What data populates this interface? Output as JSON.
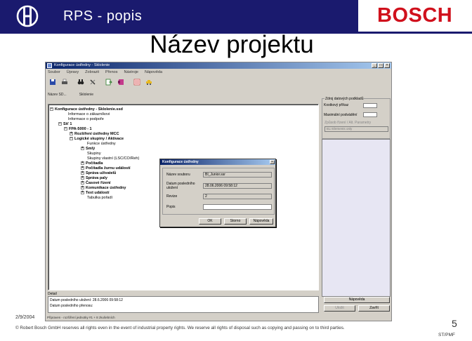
{
  "header": {
    "title": "RPS - popis",
    "brand": "BOSCH"
  },
  "slide": {
    "heading": "Název projektu"
  },
  "app": {
    "window_title": "Konfigurace ústředny - Sklolenie",
    "menu": [
      "Soubor",
      "Úpravy",
      "Zobrazit",
      "Přenos",
      "Nástroje",
      "Nápověda"
    ],
    "toolbar_icons": [
      "save-icon",
      "print-icon",
      "binoculars-icon",
      "tools-icon",
      "export-icon",
      "import-icon",
      "folder-icon",
      "list-icon",
      "car-icon"
    ],
    "toolbar_labels": [
      "Název SD...",
      "Sklolenie"
    ],
    "tree": [
      {
        "label": "Konfigurace ústředny - Sklolenie.ssd",
        "bold": true
      },
      {
        "label": "Informace o zákazníkovi",
        "bold": false
      },
      {
        "label": "Informace o podpoře",
        "bold": false
      },
      {
        "label": "Síť 1",
        "bold": true
      },
      {
        "label": "FPA-5000 - 1",
        "bold": true
      },
      {
        "label": "Rozšíření ústředny MCC",
        "bold": true
      },
      {
        "label": "Logické skupiny / Aktivace",
        "bold": true
      },
      {
        "label": "Funkce ústředny",
        "bold": false
      },
      {
        "label": "Smlý",
        "bold": true
      },
      {
        "label": "Skupiny",
        "bold": false
      },
      {
        "label": "Skupiny vlastní (LSC/CO/Reh)",
        "bold": false
      },
      {
        "label": "Počítadla",
        "bold": true
      },
      {
        "label": "Počítadla žurnu událostí",
        "bold": true
      },
      {
        "label": "Správa uživatelů",
        "bold": true
      },
      {
        "label": "Správa paly",
        "bold": true
      },
      {
        "label": "Časové řízení",
        "bold": true
      },
      {
        "label": "Komunikace ústředny",
        "bold": true
      },
      {
        "label": "Text událostí",
        "bold": true
      },
      {
        "label": "Tabulka pořadí",
        "bold": false
      }
    ],
    "right_panel": {
      "group_title": "Zdroj datových podkladů",
      "label1": "Kostkový příkaz",
      "label2": "Maximální podvádění",
      "select_label": "Způsob řízení / Alt. Parametry",
      "select_value": "ELI Elements only"
    },
    "detail": {
      "label": "Detail",
      "rows": [
        "Datum posledního uložení:  28.6.2006 09:58:12",
        "Datum posledního přenosu:"
      ]
    },
    "buttons": {
      "help": "Nápověda",
      "ok_disabled": "Uložit",
      "close": "Zavřít"
    },
    "statusbar": "Připraven - rozšíření jednotky #1 + 8 zkušebních"
  },
  "dialog": {
    "title": "Konfigurace ústředny",
    "fields": [
      {
        "label": "Název souboru",
        "value": "BI_Junior.ssr",
        "editable": false
      },
      {
        "label": "Datum posledního uložení",
        "value": "28.06.2006 09:58:12",
        "editable": false
      },
      {
        "label": "Revize",
        "value": "2",
        "editable": false
      },
      {
        "label": "Popis",
        "value": "",
        "editable": true
      }
    ],
    "ok": "OK",
    "cancel": "Storno",
    "help": "Nápověda"
  },
  "footer": {
    "date": "2/9/2004",
    "copyright": "© Robert Bosch GmbH reserves all rights even in the event of industrial property rights. We reserve all rights of disposal such as copying and passing on to third parties.",
    "page": "5",
    "dept": "ST/PMF"
  },
  "colors": {
    "header_blue": "#1a1a6e",
    "brand_red": "#d0101c",
    "titlebar_blue": "#0a246a"
  }
}
